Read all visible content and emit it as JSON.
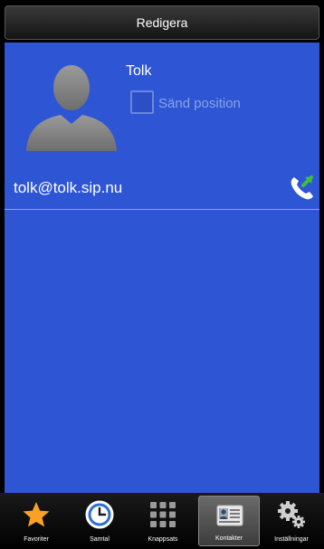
{
  "header": {
    "title": "Redigera"
  },
  "contact": {
    "name": "Tolk",
    "send_position_label": "Sänd position",
    "send_position_checked": false,
    "sip_address": "tolk@tolk.sip.nu"
  },
  "tabs": [
    {
      "label": "Favoriter",
      "icon": "star-icon"
    },
    {
      "label": "Samtal",
      "icon": "clock-icon"
    },
    {
      "label": "Knappsats",
      "icon": "keypad-icon"
    },
    {
      "label": "Kontakter",
      "icon": "contact-card-icon",
      "active": true
    },
    {
      "label": "Inställningar",
      "icon": "gears-icon"
    }
  ],
  "colors": {
    "content_background": "#2e56d4",
    "accent_star": "#f7a126",
    "call_green": "#3fbf3a"
  }
}
